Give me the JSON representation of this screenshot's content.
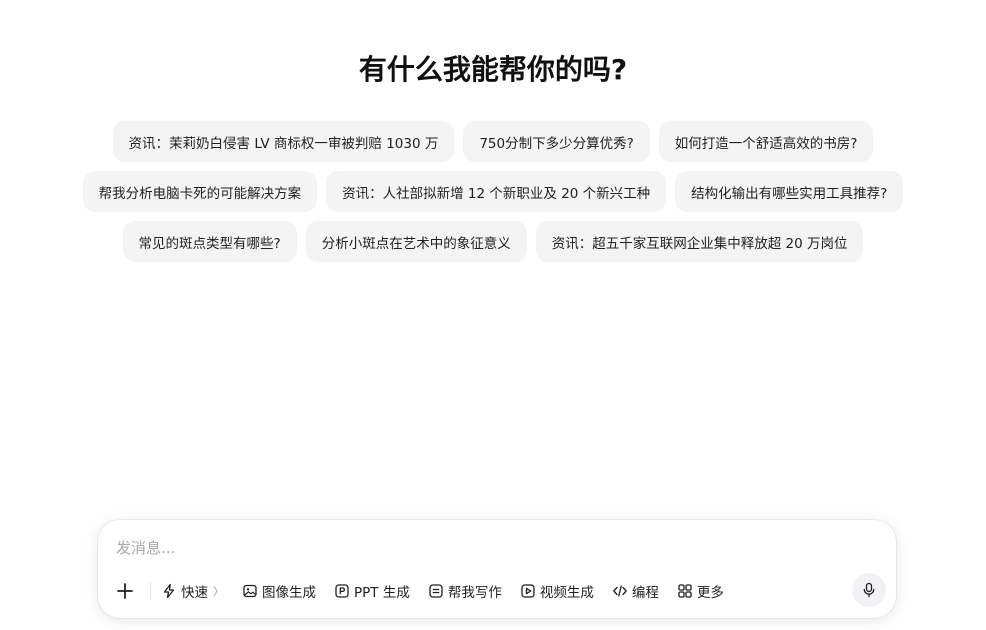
{
  "title": "有什么我能帮你的吗?",
  "suggestions": {
    "row1": [
      "资讯：茉莉奶白侵害 LV 商标权一审被判赔 1030 万",
      "750分制下多少分算优秀?",
      "如何打造一个舒适高效的书房?"
    ],
    "row2": [
      "帮我分析电脑卡死的可能解决方案",
      "资讯：人社部拟新增 12 个新职业及 20 个新兴工种",
      "结构化输出有哪些实用工具推荐?"
    ],
    "row3": [
      "常见的斑点类型有哪些?",
      "分析小斑点在艺术中的象征意义",
      "资讯：超五千家互联网企业集中释放超 20 万岗位"
    ]
  },
  "composer": {
    "placeholder": "发消息...",
    "value": "",
    "tools": {
      "fast": "快速",
      "fast_chevron": "〉",
      "image": "图像生成",
      "ppt": "PPT 生成",
      "write": "帮我写作",
      "video": "视频生成",
      "code": "编程",
      "more": "更多"
    }
  },
  "icons": {
    "plus": "plus-icon",
    "fast": "lightning-icon",
    "image": "image-icon",
    "ppt": "ppt-icon",
    "write": "write-icon",
    "video": "video-icon",
    "code": "code-icon",
    "more": "grid-icon",
    "mic": "microphone-icon"
  }
}
